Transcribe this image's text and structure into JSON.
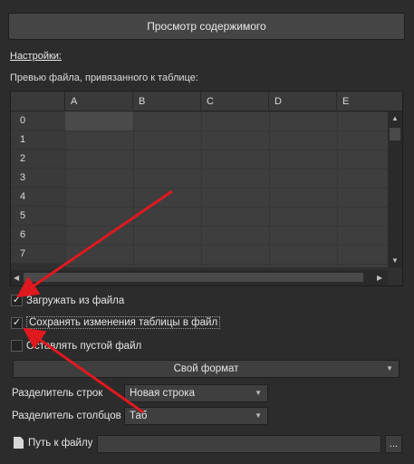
{
  "header": {
    "title": "Просмотр содержимого"
  },
  "settings": {
    "title": "Настройки:"
  },
  "preview": {
    "caption": "Превью файла, привязанного к таблице:",
    "columns": [
      "A",
      "B",
      "C",
      "D",
      "E"
    ],
    "rows": [
      "0",
      "1",
      "2",
      "3",
      "4",
      "5",
      "6",
      "7"
    ]
  },
  "checkboxes": [
    {
      "label": "Загружать из файла",
      "checked": true
    },
    {
      "label": "Сохранять изменения таблицы в файл",
      "checked": true
    },
    {
      "label": "Оставлять пустой файл",
      "checked": false
    }
  ],
  "format_button": {
    "label": "Свой формат"
  },
  "fields": {
    "row_separator": {
      "label": "Разделитель строк",
      "value": "Новая строка"
    },
    "col_separator": {
      "label": "Разделитель столбцов",
      "value": "Таб"
    }
  },
  "file_path": {
    "label": "Путь к файлу",
    "value": "",
    "browse_label": "..."
  },
  "colors": {
    "background": "#2c2c2c",
    "annotation_arrow": "#e0191f"
  }
}
